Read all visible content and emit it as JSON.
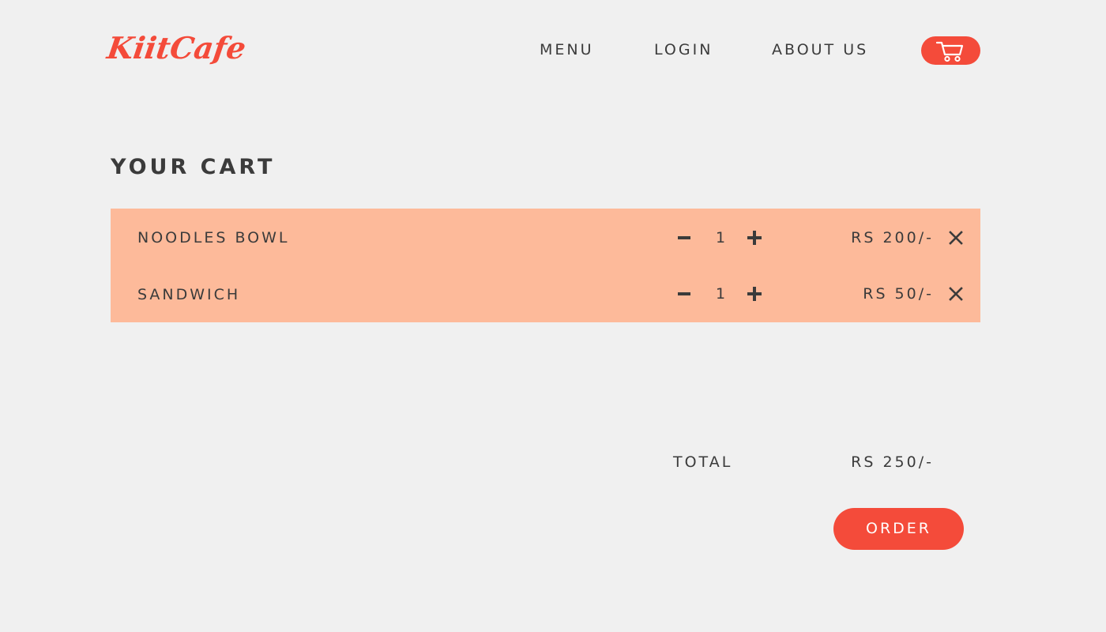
{
  "header": {
    "logo_text": "KiitCafe",
    "nav": {
      "menu_label": "MENU",
      "login_label": "LOGIN",
      "about_label": "ABOUT US"
    },
    "cart_icon": "shopping-cart-icon"
  },
  "page": {
    "title": "YOUR CART"
  },
  "cart": {
    "items": [
      {
        "name": "NOODLES BOWL",
        "quantity": "1",
        "price": "RS 200/-"
      },
      {
        "name": "SANDWICH",
        "quantity": "1",
        "price": "RS 50/-"
      }
    ],
    "icons": {
      "decrease": "minus-icon",
      "increase": "plus-icon",
      "remove": "close-icon"
    }
  },
  "summary": {
    "total_label": "TOTAL",
    "total_value": "RS 250/-",
    "order_label": "ORDER"
  },
  "colors": {
    "background": "#f0f0f0",
    "accent": "#f44b3a",
    "cart_panel": "#fdba9a",
    "text": "#3b3b3b"
  }
}
